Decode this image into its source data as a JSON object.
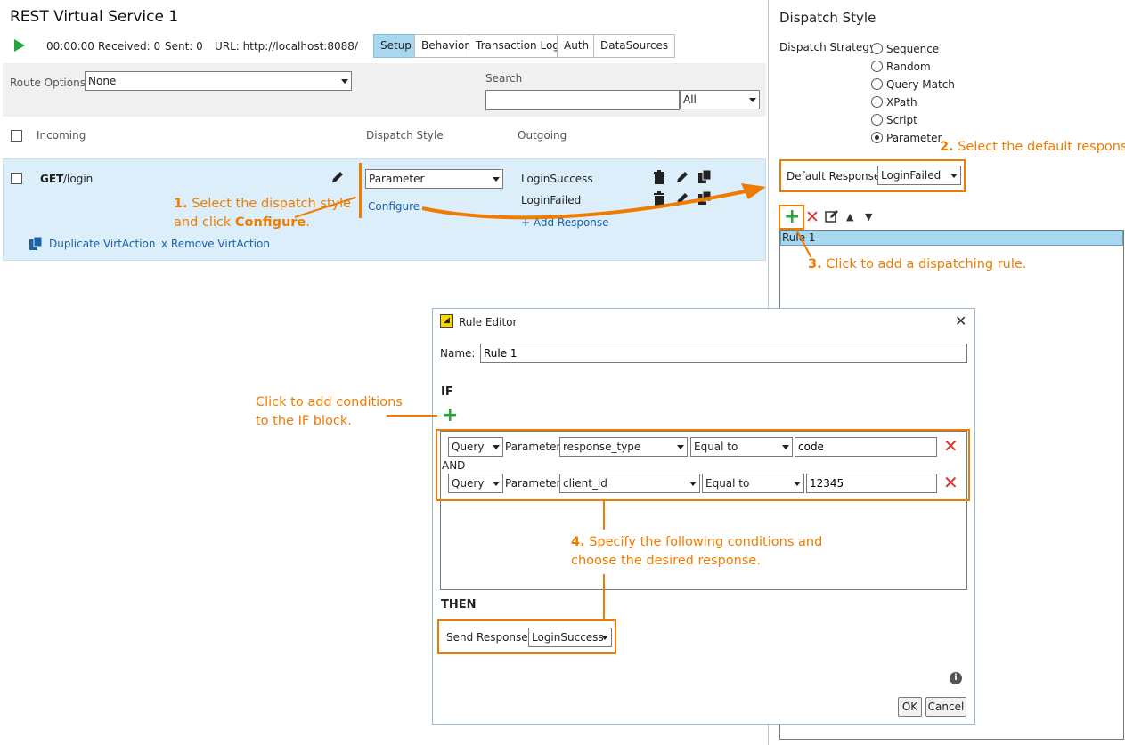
{
  "left": {
    "title": "REST Virtual Service 1",
    "status": {
      "time": "00:00:00",
      "received": "Received: 0",
      "sent": "Sent: 0",
      "url": "URL: http://localhost:8088/"
    },
    "tabs": [
      "Setup",
      "Behavior",
      "Transaction Log",
      "Auth",
      "DataSources"
    ],
    "route_label": "Route Options",
    "route_value": "None",
    "search_label": "Search",
    "search_value": "",
    "search_scope": "All",
    "columns": {
      "incoming": "Incoming",
      "dispatch": "Dispatch Style",
      "outgoing": "Outgoing"
    },
    "row": {
      "method": "GET",
      "path": "/login",
      "dispatch_value": "Parameter",
      "configure": "Configure",
      "responses": [
        "LoginSuccess",
        "LoginFailed"
      ],
      "add_response": "+ Add Response",
      "duplicate": "Duplicate VirtAction",
      "remove": "x Remove VirtAction"
    }
  },
  "right": {
    "title": "Dispatch Style",
    "strategy_label": "Dispatch Strategy:",
    "strategies": [
      "Sequence",
      "Random",
      "Query Match",
      "XPath",
      "Script",
      "Parameter"
    ],
    "selected": "Parameter",
    "default_label": "Default Response:",
    "default_value": "LoginFailed",
    "rule_item": "Rule 1"
  },
  "dialog": {
    "title": "Rule Editor",
    "name_label": "Name:",
    "name_value": "Rule 1",
    "if_label": "IF",
    "conditions": [
      {
        "source": "Query",
        "param_label": "Parameter:",
        "param": "response_type",
        "op": "Equal to",
        "value": "code"
      },
      {
        "source": "Query",
        "param_label": "Parameter:",
        "param": "client_id",
        "op": "Equal to",
        "value": "12345"
      }
    ],
    "and_label": "AND",
    "then_label": "THEN",
    "send_label": "Send Response:",
    "send_value": "LoginSuccess",
    "ok": "OK",
    "cancel": "Cancel"
  },
  "annotations": {
    "a1_num": "1.",
    "a1_line1": " Select the dispatch style",
    "a1_line2a": "and click ",
    "a1_bold": "Configure",
    "a1_line2b": ".",
    "a2_num": "2.",
    "a2_text": " Select the default response.",
    "a3_num": "3.",
    "a3_text": " Click to add a dispatching rule.",
    "a4_num": "4.",
    "a4_line1": " Specify the following conditions and",
    "a4_line2": "choose the desired response.",
    "cond_line1": "Click to add conditions",
    "cond_line2": "to the IF block."
  },
  "colors": {
    "accent": "#ef7c00",
    "selected_tab": "#a7d8f0",
    "row_bg": "#dceefa",
    "add": "#2aa642",
    "delete": "#e0312b"
  }
}
